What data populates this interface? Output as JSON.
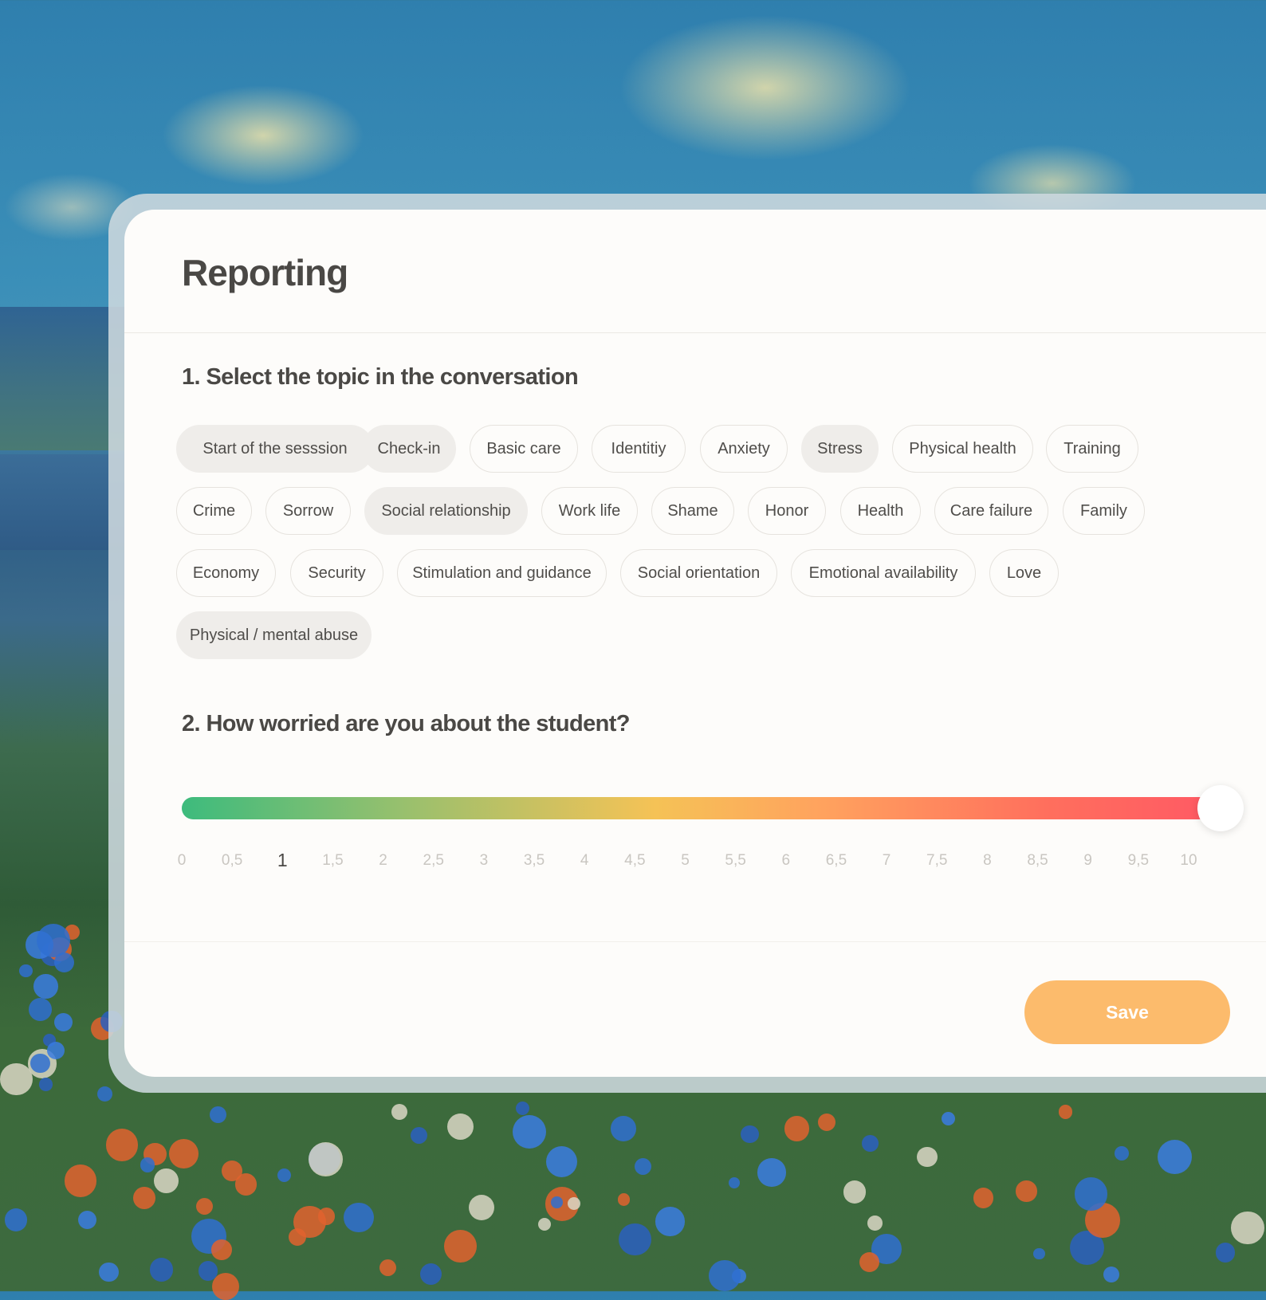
{
  "page": {
    "title": "Reporting"
  },
  "sections": {
    "topics_title": "1. Select the topic in the conversation",
    "worry_title": "2. How worried are you about the student?"
  },
  "topics": [
    {
      "label": "Start of the sesssion",
      "selected": true
    },
    {
      "label": "Check-in",
      "selected": true
    },
    {
      "label": "Basic care",
      "selected": false
    },
    {
      "label": "Identitiy",
      "selected": false
    },
    {
      "label": "Anxiety",
      "selected": false
    },
    {
      "label": "Stress",
      "selected": true
    },
    {
      "label": "Physical health",
      "selected": false
    },
    {
      "label": "Training",
      "selected": false
    },
    {
      "label": "Crime",
      "selected": false
    },
    {
      "label": "Sorrow",
      "selected": false
    },
    {
      "label": "Social relationship",
      "selected": true
    },
    {
      "label": "Work life",
      "selected": false
    },
    {
      "label": "Shame",
      "selected": false
    },
    {
      "label": "Honor",
      "selected": false
    },
    {
      "label": "Health",
      "selected": false
    },
    {
      "label": "Care failure",
      "selected": false
    },
    {
      "label": "Family",
      "selected": false
    },
    {
      "label": "Economy",
      "selected": false
    },
    {
      "label": "Security",
      "selected": false
    },
    {
      "label": "Stimulation and guidance",
      "selected": false
    },
    {
      "label": "Social orientation",
      "selected": false
    },
    {
      "label": "Emotional availability",
      "selected": false
    },
    {
      "label": "Love",
      "selected": false
    },
    {
      "label": "Physical / mental abuse",
      "selected": true
    }
  ],
  "slider": {
    "min": 0,
    "max": 10,
    "step": 0.5,
    "value": 10,
    "highlighted_label": "1",
    "ticks": [
      "0",
      "0,5",
      "1",
      "1,5",
      "2",
      "2,5",
      "3",
      "3,5",
      "4",
      "4,5",
      "5",
      "5,5",
      "6",
      "6,5",
      "7",
      "7,5",
      "8",
      "8,5",
      "9",
      "9,5",
      "10"
    ],
    "colors": [
      "#3dbb7d",
      "#f5c256",
      "#ff5a64"
    ]
  },
  "actions": {
    "save_label": "Save",
    "save_color": "#fcbb6c"
  }
}
